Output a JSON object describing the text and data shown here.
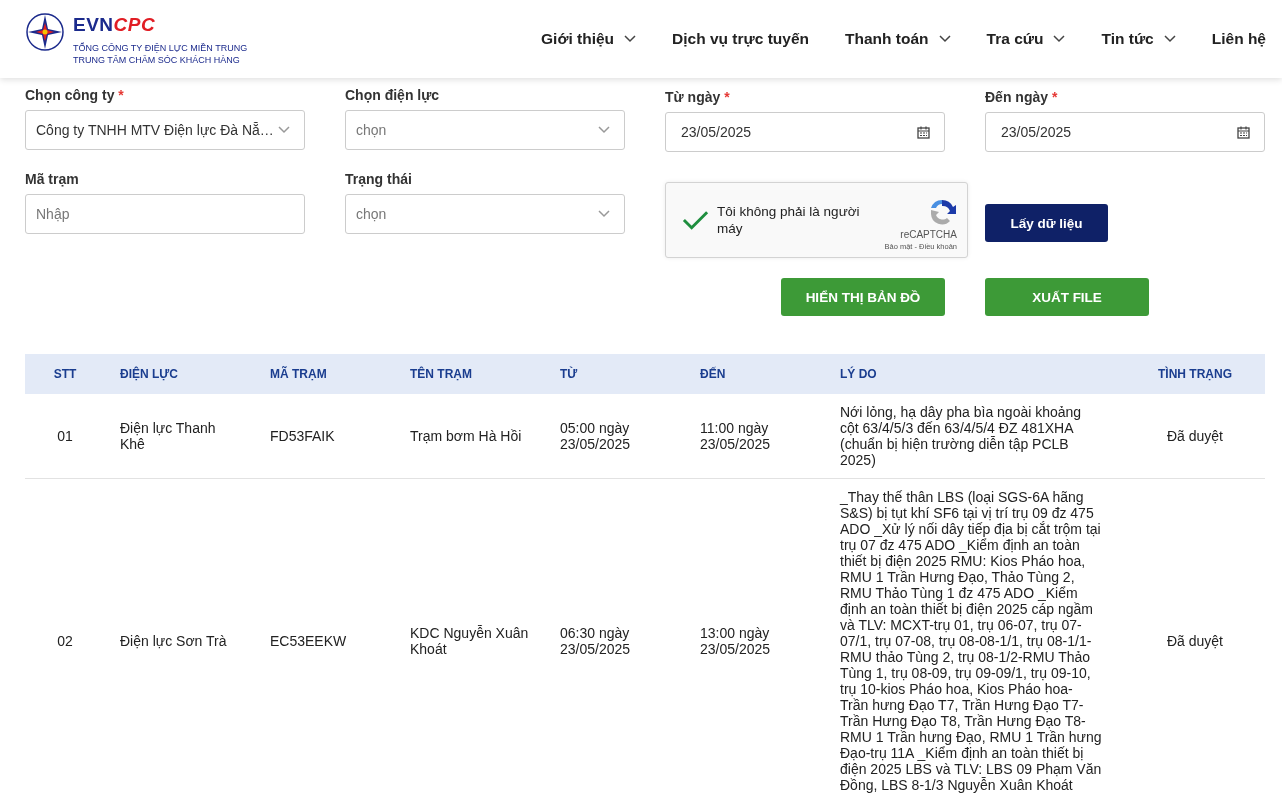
{
  "header": {
    "logo": {
      "brand_main": "EVN",
      "brand_accent": "CPC",
      "line1": "TỔNG CÔNG TY ĐIỆN LỰC MIỀN TRUNG",
      "line2": "TRUNG TÂM CHĂM SÓC KHÁCH HÀNG"
    },
    "nav": [
      {
        "label": "Giới thiệu",
        "dropdown": true
      },
      {
        "label": "Dịch vụ trực tuyến",
        "dropdown": false
      },
      {
        "label": "Thanh toán",
        "dropdown": true
      },
      {
        "label": "Tra cứu",
        "dropdown": true
      },
      {
        "label": "Tin tức",
        "dropdown": true
      },
      {
        "label": "Liên hệ",
        "dropdown": false
      }
    ]
  },
  "filters": [
    {
      "kind": "select",
      "label": "Chọn công ty",
      "required_mark": "*",
      "value": "Công ty TNHH MTV Điện lực Đà Nẵ…"
    },
    {
      "kind": "select",
      "label": "Chọn điện lực",
      "placeholder": "chọn"
    },
    {
      "kind": "date",
      "label": "Từ ngày",
      "required_mark": "*",
      "value": "23/05/2025"
    },
    {
      "kind": "date",
      "label": "Đến ngày",
      "required_mark": "*",
      "value": "23/05/2025"
    },
    {
      "kind": "text",
      "label": "Mã trạm",
      "placeholder": "Nhập"
    },
    {
      "kind": "select",
      "label": "Trạng thái",
      "placeholder": "chọn"
    }
  ],
  "captcha": {
    "label": "Tôi không phải là người máy",
    "checked": true,
    "brand": "reCAPTCHA",
    "links": "Bảo mật - Điều khoản"
  },
  "buttons": [
    {
      "label": "Lấy dữ liệu",
      "kind": "primary"
    },
    {
      "label": "HIỂN THỊ BẢN ĐỒ",
      "kind": "success"
    },
    {
      "label": "XUẤT FILE",
      "kind": "success"
    }
  ],
  "table": {
    "columns": [
      "STT",
      "ĐIỆN LỰC",
      "MÃ TRẠM",
      "TÊN TRẠM",
      "TỪ",
      "ĐẾN",
      "LÝ DO",
      "TÌNH TRẠNG"
    ],
    "rows": [
      [
        "01",
        "Điện lực Thanh Khê",
        "FD53FAIK",
        "Trạm bơm Hà Hồi",
        "05:00 ngày 23/05/2025",
        "11:00 ngày 23/05/2025",
        "Nới lỏng, hạ dây pha bìa ngoài khoảng cột 63/4/5/3 đến 63/4/5/4 ĐZ 481XHA (chuẩn bị hiện trường diễn tập PCLB 2025)",
        "Đã duyệt"
      ],
      [
        "02",
        "Điện lực Sơn Trà",
        "EC53EEKW",
        "KDC Nguyễn Xuân Khoát",
        "06:30 ngày 23/05/2025",
        "13:00 ngày 23/05/2025",
        "_Thay thế thân LBS (loại SGS-6A hãng S&S) bị tụt khí SF6 tại vị trí trụ 09 đz 475 ADO _Xử lý nối dây tiếp địa bị cắt trộm tại trụ 07 đz 475 ADO _Kiểm định an toàn thiết bị điện 2025 RMU: Kios Pháo hoa, RMU 1 Trần Hưng Đạo, Thảo Tùng 2, RMU Thảo Tùng 1 đz 475 ADO _Kiểm định an toàn thiết bị điện 2025 cáp ngầm và TLV: MCXT-trụ 01, trụ 06-07, trụ 07-07/1, trụ 07-08, trụ 08-08-1/1, trụ 08-1/1-RMU thảo Tùng 2, trụ 08-1/2-RMU Thảo Tùng 1, trụ 08-09, trụ 09-09/1, trụ 09-10, trụ 10-kios Pháo hoa, Kios Pháo hoa- Trần hưng Đạo T7, Trần Hưng Đạo T7- Trần Hưng Đạo T8, Trần Hưng Đạo T8-RMU 1 Trần hưng Đạo, RMU 1 Trần hưng Đạo-trụ 11A _Kiểm định an toàn thiết bị điện 2025 LBS và TLV: LBS 09 Phạm Văn Đồng, LBS 8-1/3 Nguyễn Xuân Khoát",
        "Đã duyệt"
      ]
    ]
  }
}
